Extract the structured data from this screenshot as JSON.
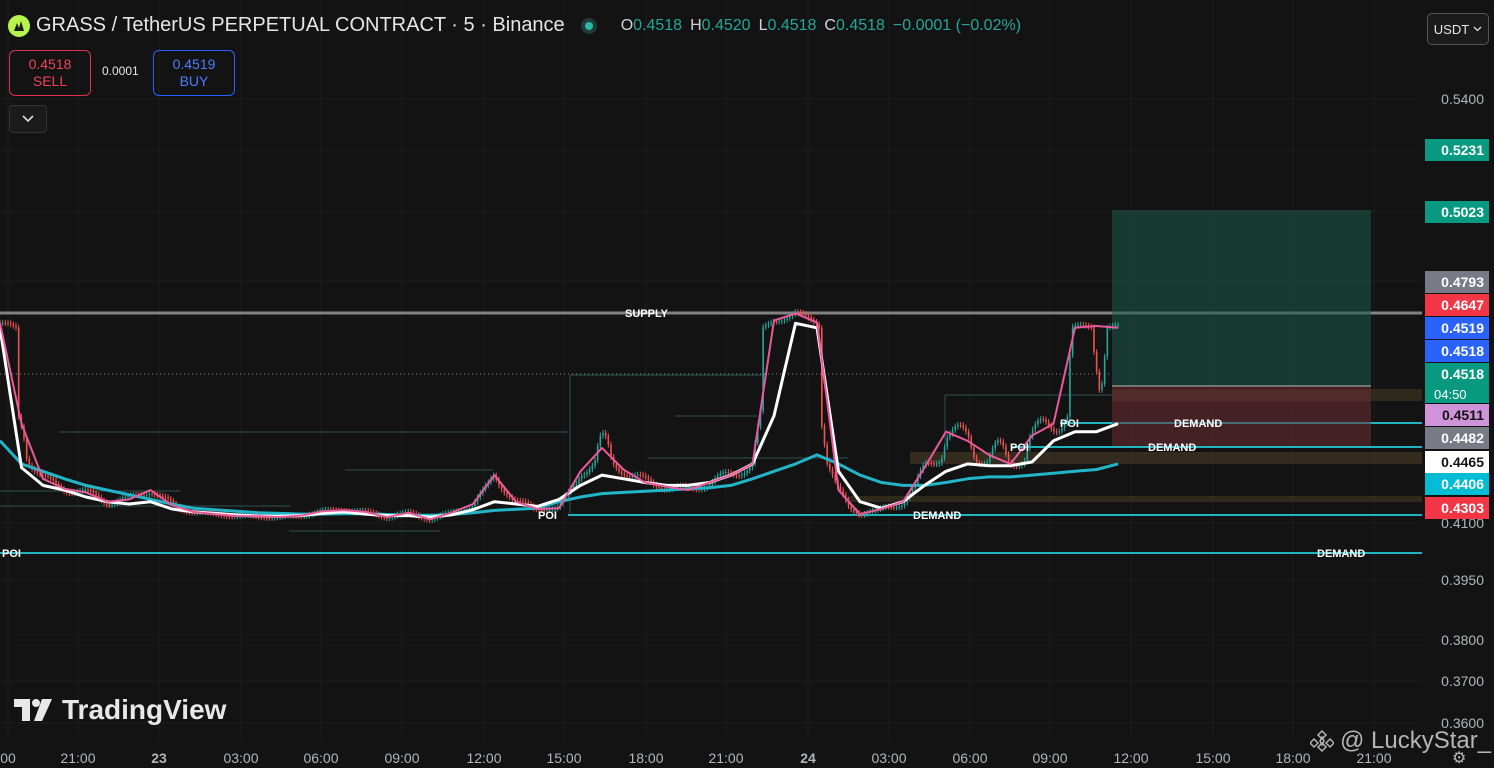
{
  "header": {
    "title": "GRASS / TetherUS PERPETUAL CONTRACT · 5 · Binance",
    "ohlc": [
      {
        "k": "O",
        "v": "0.4518"
      },
      {
        "k": "H",
        "v": "0.4520"
      },
      {
        "k": "L",
        "v": "0.4518"
      },
      {
        "k": "C",
        "v": "0.4518"
      }
    ],
    "change": "−0.0001 (−0.02%)"
  },
  "trade": {
    "sell_price": "0.4518",
    "sell_label": "SELL",
    "spread": "0.0001",
    "buy_price": "0.4519",
    "buy_label": "BUY"
  },
  "currency_selector": "USDT",
  "branding": {
    "logo_text": "TradingView",
    "watermark": "@ LuckyStar_"
  },
  "colors": {
    "background": "#131313",
    "up": "#26a69a",
    "down": "#ef5350",
    "ema_fast": "#e85a9b",
    "ema_mid": "#ffffff",
    "ema_slow": "#22b5c8",
    "zone_line": "#1fb6c0",
    "supply_line": "#9e9e9e"
  },
  "chart_data": {
    "type": "line",
    "symbol": "GRASS/USDT.P",
    "timeframe": "5",
    "y_axis_ticks": [
      "0.5400",
      "0.5231",
      "0.5023",
      "0.4793",
      "0.4647",
      "0.4519",
      "0.4518",
      "0.4511",
      "0.4482",
      "0.4465",
      "0.4406",
      "0.4303",
      "0.4100",
      "0.3950",
      "0.3800",
      "0.3700",
      "0.3600"
    ],
    "ylim": [
      0.36,
      0.55
    ],
    "x_axis_ticks": [
      "00",
      "21:00",
      "23",
      "03:00",
      "06:00",
      "09:00",
      "12:00",
      "15:00",
      "18:00",
      "21:00",
      "24",
      "03:00",
      "06:00",
      "09:00",
      "12:00",
      "15:00",
      "18:00",
      "21:00"
    ],
    "price_labels": [
      {
        "value": "0.5231",
        "color": "#089981"
      },
      {
        "value": "0.5023",
        "color": "#089981"
      },
      {
        "value": "0.4793",
        "color": "#787b86"
      },
      {
        "value": "0.4647",
        "color": "#f23645"
      },
      {
        "value": "0.4519",
        "color": "#2962ff"
      },
      {
        "value": "0.4518",
        "color": "#2962ff"
      },
      {
        "value": "0.4518",
        "color": "#089981"
      },
      {
        "value": "0.4511",
        "color": "#ce93d8"
      },
      {
        "value": "0.4482",
        "color": "#787b86"
      },
      {
        "value": "0.4465",
        "color": "#ffffff"
      },
      {
        "value": "0.4406",
        "color": "#00bcd4"
      },
      {
        "value": "0.4303",
        "color": "#f23645"
      }
    ],
    "countdown": "04:50",
    "series": [
      {
        "values": [
          0.4548,
          0.45,
          0.442,
          0.4385,
          0.437,
          0.433,
          0.434,
          0.438,
          0.4315,
          0.425,
          0.422,
          0.4195,
          0.419,
          0.418,
          0.42,
          0.426,
          0.4275,
          0.425,
          0.418,
          0.424,
          0.415,
          0.424,
          0.432,
          0.443,
          0.433,
          0.429,
          0.43,
          0.444,
          0.4475,
          0.4445,
          0.441,
          0.4395,
          0.438,
          0.441,
          0.443,
          0.446,
          0.456,
          0.46,
          0.455,
          0.438,
          0.422,
          0.429,
          0.433,
          0.445,
          0.449,
          0.448,
          0.447,
          0.446,
          0.4485,
          0.45,
          0.452,
          0.453,
          0.452
        ]
      },
      {
        "values": [
          0.452,
          0.445,
          0.44,
          0.438,
          0.435,
          0.433,
          0.432,
          0.433,
          0.429,
          0.425,
          0.423,
          0.421,
          0.4195,
          0.419,
          0.42,
          0.423,
          0.425,
          0.422,
          0.42,
          0.42,
          0.418,
          0.421,
          0.428,
          0.433,
          0.432,
          0.431,
          0.434,
          0.44,
          0.443,
          0.442,
          0.441,
          0.44,
          0.44,
          0.441,
          0.443,
          0.446,
          0.451,
          0.4545,
          0.452,
          0.444,
          0.433,
          0.43,
          0.433,
          0.44,
          0.444,
          0.446,
          0.4455,
          0.4455,
          0.4465,
          0.448,
          0.449,
          0.449,
          0.45
        ]
      },
      {
        "values": [
          0.448,
          0.446,
          0.444,
          0.442,
          0.44,
          0.438,
          0.436,
          0.434,
          0.432,
          0.43,
          0.428,
          0.426,
          0.424,
          0.423,
          0.422,
          0.422,
          0.4225,
          0.4225,
          0.4215,
          0.4205,
          0.4205,
          0.4215,
          0.424,
          0.427,
          0.4285,
          0.43,
          0.433,
          0.435,
          0.4365,
          0.437,
          0.4375,
          0.438,
          0.4385,
          0.439,
          0.44,
          0.442,
          0.444,
          0.446,
          0.447,
          0.446,
          0.443,
          0.441,
          0.44,
          0.44,
          0.441,
          0.442,
          0.4425,
          0.4425,
          0.443,
          0.4435,
          0.444,
          0.4445,
          0.446
        ]
      }
    ],
    "lines": [
      {
        "label": "SUPPLY",
        "price": 0.4647
      },
      {
        "label": "POI",
        "price": 0.432
      },
      {
        "label": "DEMAND",
        "price": 0.4303
      },
      {
        "label": "POI",
        "price": 0.4395
      },
      {
        "label": "DEMAND",
        "price": 0.4395
      },
      {
        "label": "POI",
        "price": 0.4425
      },
      {
        "label": "DEMAND",
        "price": 0.4425
      },
      {
        "label": "POI",
        "price": 0.425
      },
      {
        "label": "DEMAND",
        "price": 0.425
      }
    ],
    "position": {
      "entry": 0.4518,
      "stop": 0.44,
      "target": 0.5023
    }
  }
}
